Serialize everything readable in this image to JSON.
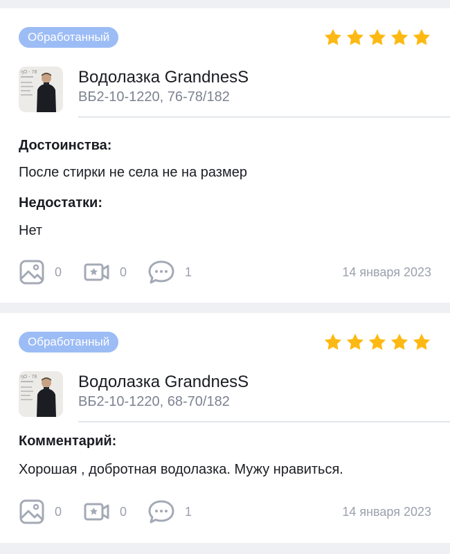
{
  "colors": {
    "badge": "#9cbcf5",
    "star": "#fdb913",
    "muted": "#9aa0ac"
  },
  "reviews": [
    {
      "status": "Обработанный",
      "rating": 5,
      "thumb_text": "ŋO - 78",
      "product_name": "Водолазка GrandnesS",
      "variant": "ВБ2-10-1220, 76-78/182",
      "sections": [
        {
          "label": "Достоинства:",
          "text": "После стирки не села не на размер"
        },
        {
          "label": "Недостатки:",
          "text": "Нет"
        }
      ],
      "photo_count": "0",
      "video_count": "0",
      "comment_count": "1",
      "date": "14 января 2023"
    },
    {
      "status": "Обработанный",
      "rating": 5,
      "thumb_text": "ŋO - 78",
      "product_name": "Водолазка GrandnesS",
      "variant": "ВБ2-10-1220, 68-70/182",
      "sections": [
        {
          "label": "Комментарий:",
          "text": "Хорошая , добротная водолазка. Мужу нравиться."
        }
      ],
      "photo_count": "0",
      "video_count": "0",
      "comment_count": "1",
      "date": "14 января 2023"
    }
  ]
}
